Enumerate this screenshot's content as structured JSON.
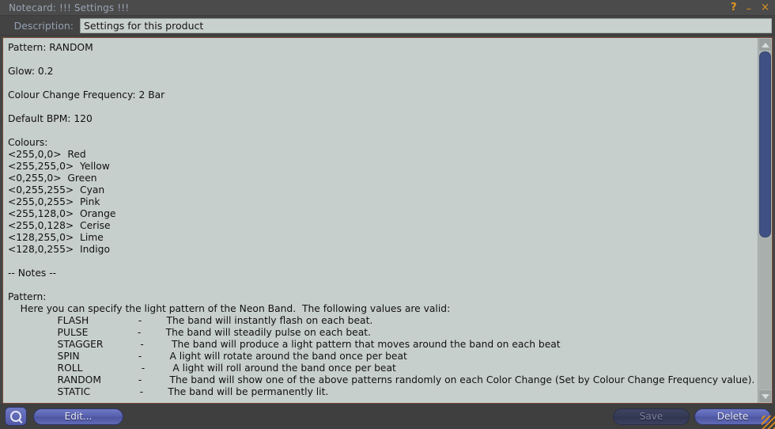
{
  "window": {
    "title": "Notecard: !!! Settings !!!",
    "controls": {
      "help": "?",
      "minimize": "–",
      "close": "×"
    }
  },
  "description": {
    "label": "Description:",
    "value": "Settings for this product",
    "placeholder": ""
  },
  "notecard": {
    "lines": [
      "Pattern: RANDOM",
      "",
      "Glow: 0.2",
      "",
      "Colour Change Frequency: 2 Bar",
      "",
      "Default BPM: 120",
      "",
      "Colours:",
      "<255,0,0>  Red",
      "<255,255,0>  Yellow",
      "<0,255,0>  Green",
      "<0,255,255>  Cyan",
      "<255,0,255>  Pink",
      "<255,128,0>  Orange",
      "<255,0,128>  Cerise",
      "<128,255,0>  Lime",
      "<128,0,255>  Indigo",
      "",
      "-- Notes --",
      "",
      "Pattern:",
      "    Here you can specify the light pattern of the Neon Band.  The following values are valid:",
      "                FLASH                -        The band will instantly flash on each beat.",
      "                PULSE                -        The band will steadily pulse on each beat.",
      "                STAGGER            -         The band will produce a light pattern that moves around the band on each beat",
      "                SPIN                   -         A light will rotate around the band once per beat",
      "                ROLL                   -         A light will roll around the band once per beat",
      "                RANDOM            -         The band will show one of the above patterns randomly on each Color Change (Set by Colour Change Frequency value).",
      "                STATIC                -        The band will be permanently lit."
    ]
  },
  "scrollbar": {
    "up_arrow": "scroll-up",
    "down_arrow": "scroll-down",
    "thumb_position_percent": 0,
    "thumb_size_percent": 55
  },
  "toolbar": {
    "search_icon": "search-icon",
    "edit_label": "Edit...",
    "save_label": "Save",
    "delete_label": "Delete"
  },
  "colors": {
    "title_text": "#9aa4b4",
    "window_control": "#e0971f",
    "body_background": "#c7cfcd",
    "body_border": "#7a4a38",
    "button_blue": "#5660ae",
    "scroll_thumb": "#3f5084",
    "grip": "#d68a1e"
  }
}
